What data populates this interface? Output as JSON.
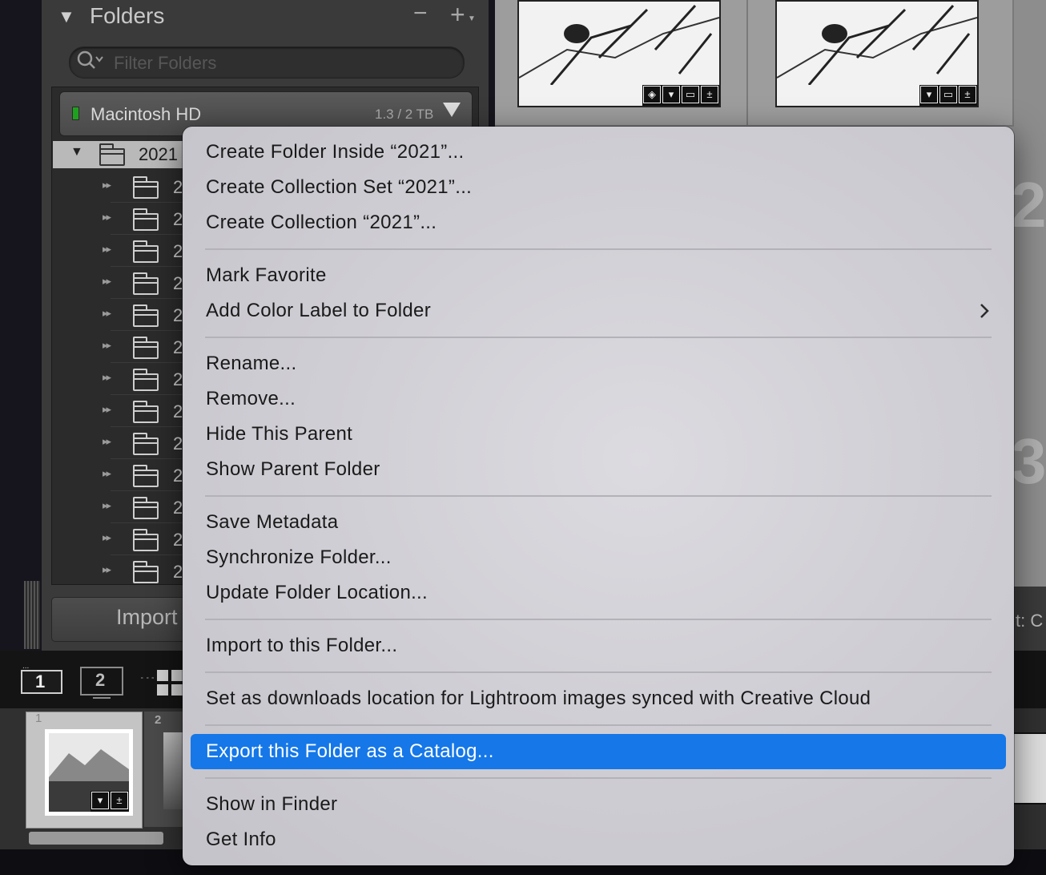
{
  "folders_panel": {
    "title": "Folders",
    "minus_label": "−",
    "plus_label": "+",
    "filter_placeholder": "Filter Folders",
    "volume": {
      "name": "Macintosh HD",
      "size": "1.3 / 2 TB"
    },
    "selected_folder": "2021",
    "subfolder_prefix": "2",
    "import_label": "Import"
  },
  "grid": {
    "cell_numbers": [
      "2",
      "3"
    ],
    "status_text": "t:  C"
  },
  "toolbar": {
    "view_1": "1",
    "view_2": "2",
    "view_1_dots": "..."
  },
  "filmstrip": {
    "cell_1_num": "1",
    "cell_2_num": "2"
  },
  "context_menu": {
    "items": [
      {
        "label": "Create Folder Inside “2021”..."
      },
      {
        "label": "Create Collection Set “2021”..."
      },
      {
        "label": "Create Collection “2021”..."
      },
      {
        "label": "Mark Favorite"
      },
      {
        "label": "Add Color Label to Folder",
        "submenu": true
      },
      {
        "label": "Rename..."
      },
      {
        "label": "Remove..."
      },
      {
        "label": "Hide This Parent"
      },
      {
        "label": "Show Parent Folder"
      },
      {
        "label": "Save Metadata"
      },
      {
        "label": "Synchronize Folder..."
      },
      {
        "label": "Update Folder Location..."
      },
      {
        "label": "Import to this Folder..."
      },
      {
        "label": "Set as downloads location for Lightroom images synced with Creative Cloud"
      },
      {
        "label": "Export this Folder as a Catalog...",
        "highlighted": true
      },
      {
        "label": "Show in Finder"
      },
      {
        "label": "Get Info"
      }
    ],
    "highlight_color": "#1577e8"
  }
}
